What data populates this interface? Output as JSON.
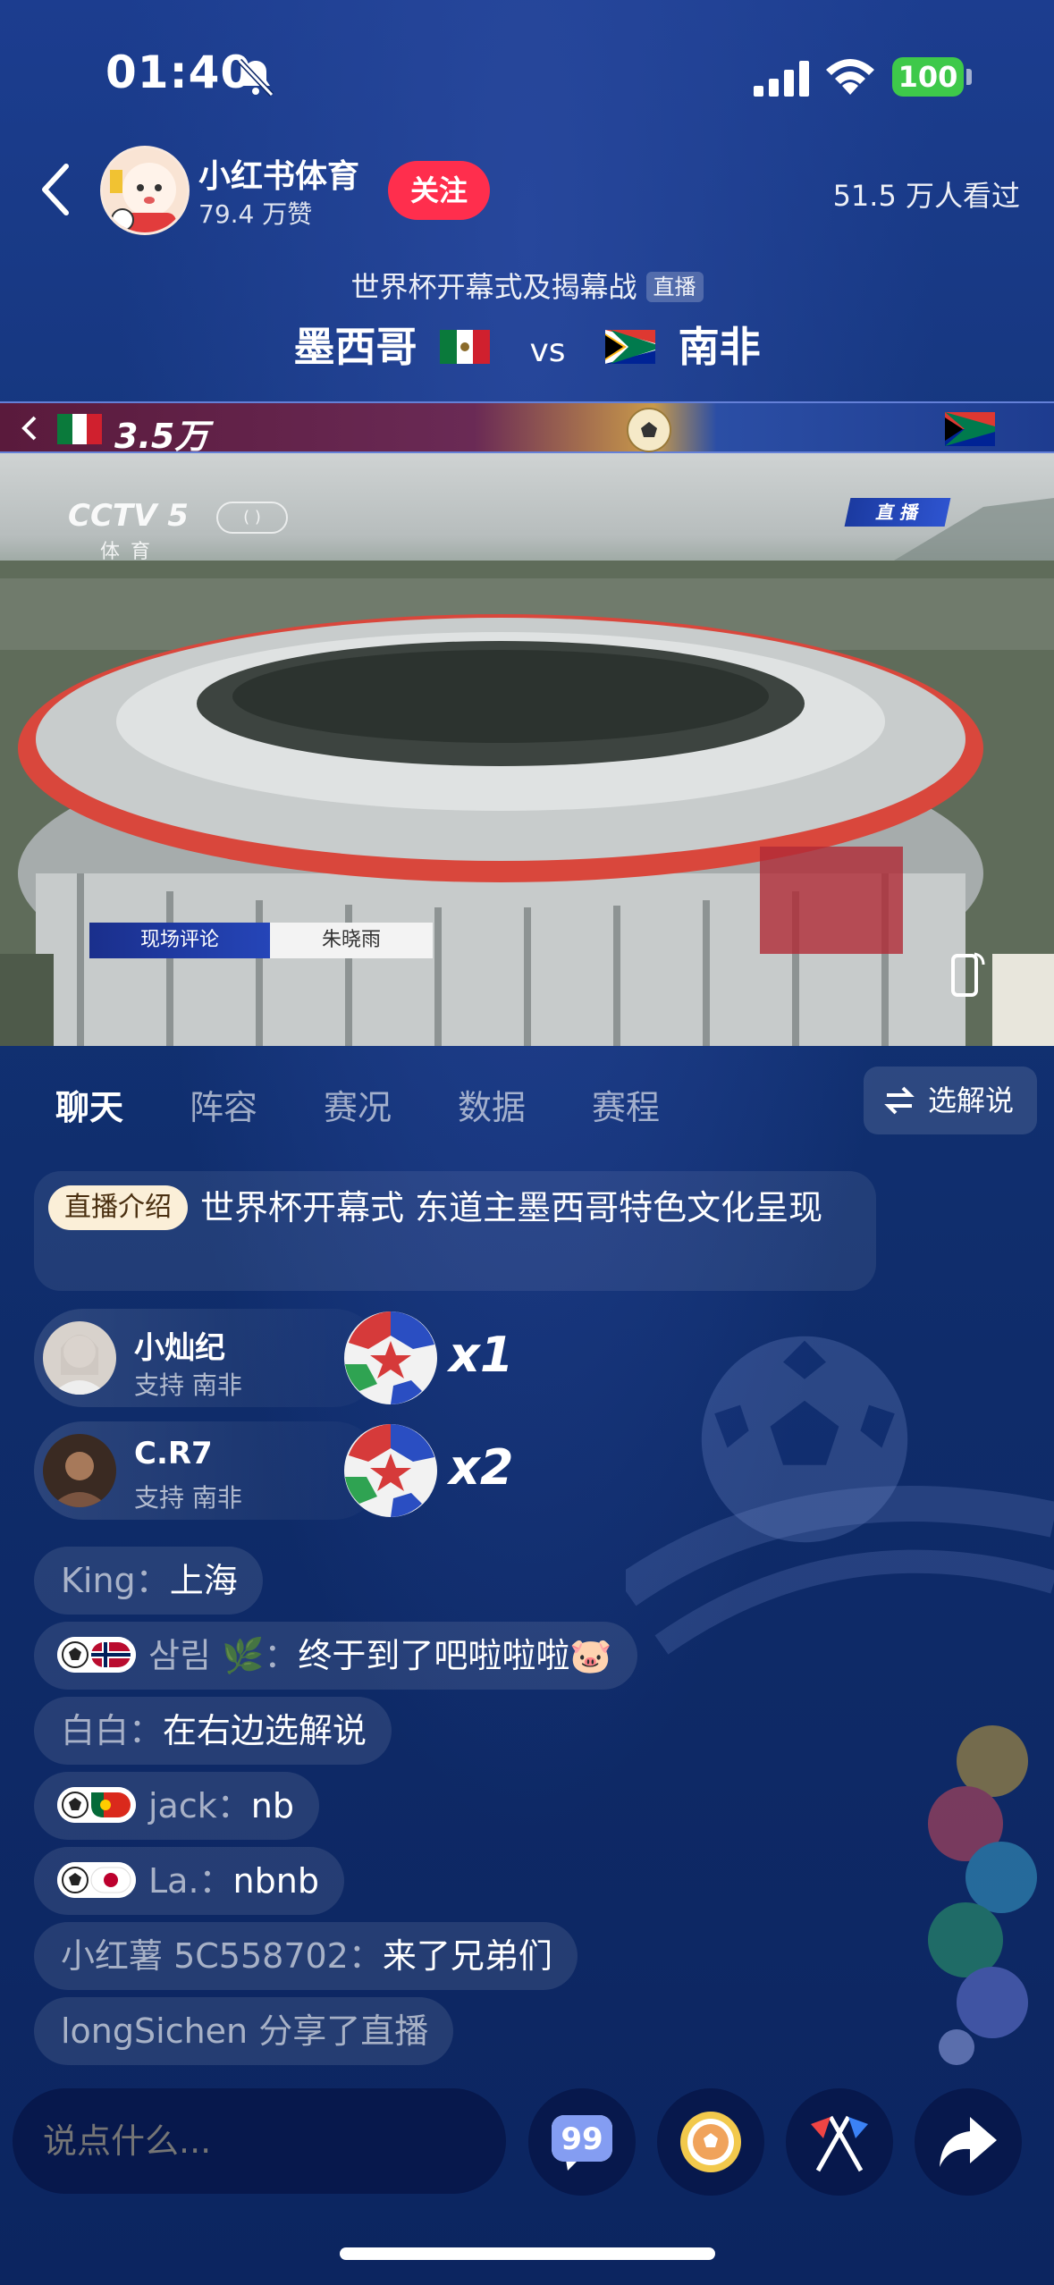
{
  "status_bar": {
    "time": "01:40",
    "battery": "100"
  },
  "header": {
    "channel_name": "小红书体育",
    "likes": "79.4 万赞",
    "follow_label": "关注",
    "viewers": "51.5 万人看过"
  },
  "event": {
    "title": "世界杯开幕式及揭幕战",
    "live_tag": "直播",
    "team_home": "墨西哥",
    "vs": "vs",
    "team_away": "南非"
  },
  "support_bar": {
    "home_support": "3.5万"
  },
  "video": {
    "channel_logo": "CCTV 5",
    "channel_logo_sub": "体育",
    "live_badge": "直 播",
    "commentator_label": "现场评论",
    "commentator_name": "朱晓雨"
  },
  "tabs": [
    {
      "label": "聊天",
      "active": true
    },
    {
      "label": "阵容",
      "active": false
    },
    {
      "label": "赛况",
      "active": false
    },
    {
      "label": "数据",
      "active": false
    },
    {
      "label": "赛程",
      "active": false
    }
  ],
  "select_commentary_label": "选解说",
  "intro": {
    "badge": "直播介绍",
    "text": "世界杯开幕式 东道主墨西哥特色文化呈现"
  },
  "gifts": [
    {
      "user": "小灿纪",
      "support": "支持 南非",
      "count": "x1"
    },
    {
      "user": "C.R7",
      "support": "支持 南非",
      "count": "x2"
    }
  ],
  "chat": [
    {
      "name": "King：",
      "text": "上海",
      "badge": ""
    },
    {
      "name": "삼림 🌿：",
      "text": "终于到了吧啦啦啦🐷",
      "badge": "norway"
    },
    {
      "name": "白白：",
      "text": "在右边选解说",
      "badge": ""
    },
    {
      "name": "jack：",
      "text": "nb",
      "badge": "portugal"
    },
    {
      "name": "La.：",
      "text": "nbnb",
      "badge": "japan"
    },
    {
      "name": "小红薯 5C558702：",
      "text": "来了兄弟们",
      "badge": ""
    },
    {
      "name": "longSichen",
      "text": " 分享了直播",
      "badge": ""
    }
  ],
  "bottom": {
    "input_placeholder": "说点什么...",
    "buttons": [
      "quote-chat-icon",
      "soccer-gift-icon",
      "flags-icon",
      "share-icon"
    ]
  },
  "colors": {
    "follow": "#ff2e4d",
    "battery": "#3ec94a",
    "background": "#133478",
    "intro_badge": "#fbefd8"
  }
}
